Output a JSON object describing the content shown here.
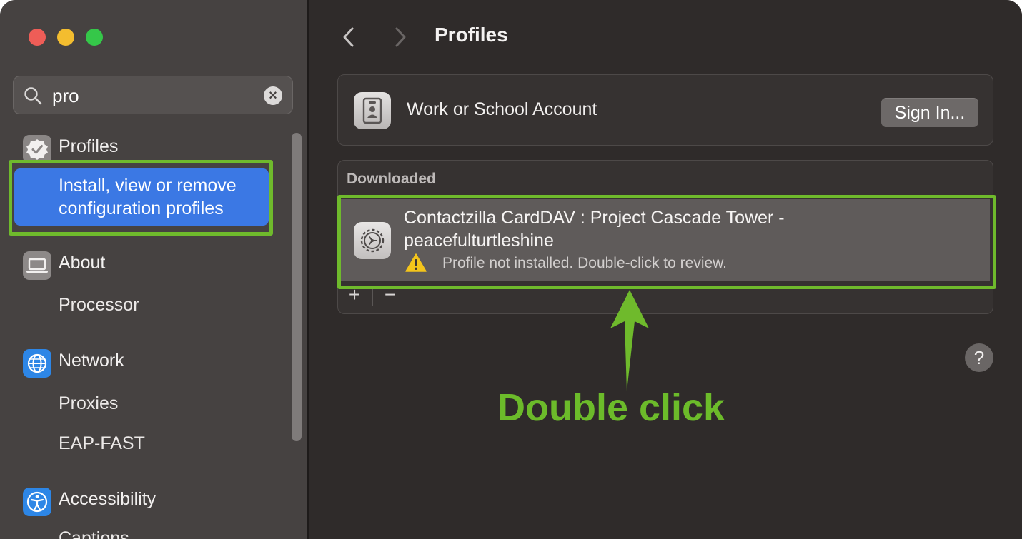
{
  "sidebar": {
    "search": {
      "value": "pro",
      "placeholder": "Search"
    },
    "items": [
      {
        "label": "Profiles",
        "icon": "checkmark-seal-icon",
        "sub": [
          "Install, view or remove",
          "configuration profiles"
        ]
      },
      {
        "label": "About",
        "icon": "laptop-icon",
        "sub": [
          "Processor"
        ]
      },
      {
        "label": "Network",
        "icon": "globe-icon",
        "sub": [
          "Proxies",
          "EAP-FAST"
        ]
      },
      {
        "label": "Accessibility",
        "icon": "accessibility-icon",
        "sub": [
          "Captions"
        ]
      }
    ]
  },
  "header": {
    "title": "Profiles",
    "back": "chevron-left-icon",
    "forward": "chevron-right-icon"
  },
  "account": {
    "label": "Work or School Account",
    "button": "Sign In..."
  },
  "downloaded": {
    "section_label": "Downloaded",
    "profile": {
      "name_line1": "Contactzilla CardDAV : Project Cascade Tower -",
      "name_line2": "peacefulturtleshine",
      "status": "Profile not installed. Double-click to review."
    },
    "add": "+",
    "remove": "−"
  },
  "help": "?",
  "annotation": {
    "text": "Double click",
    "color": "#6fba2c"
  },
  "colors": {
    "accent": "#3b78e4",
    "highlight": "#6fba2c"
  }
}
